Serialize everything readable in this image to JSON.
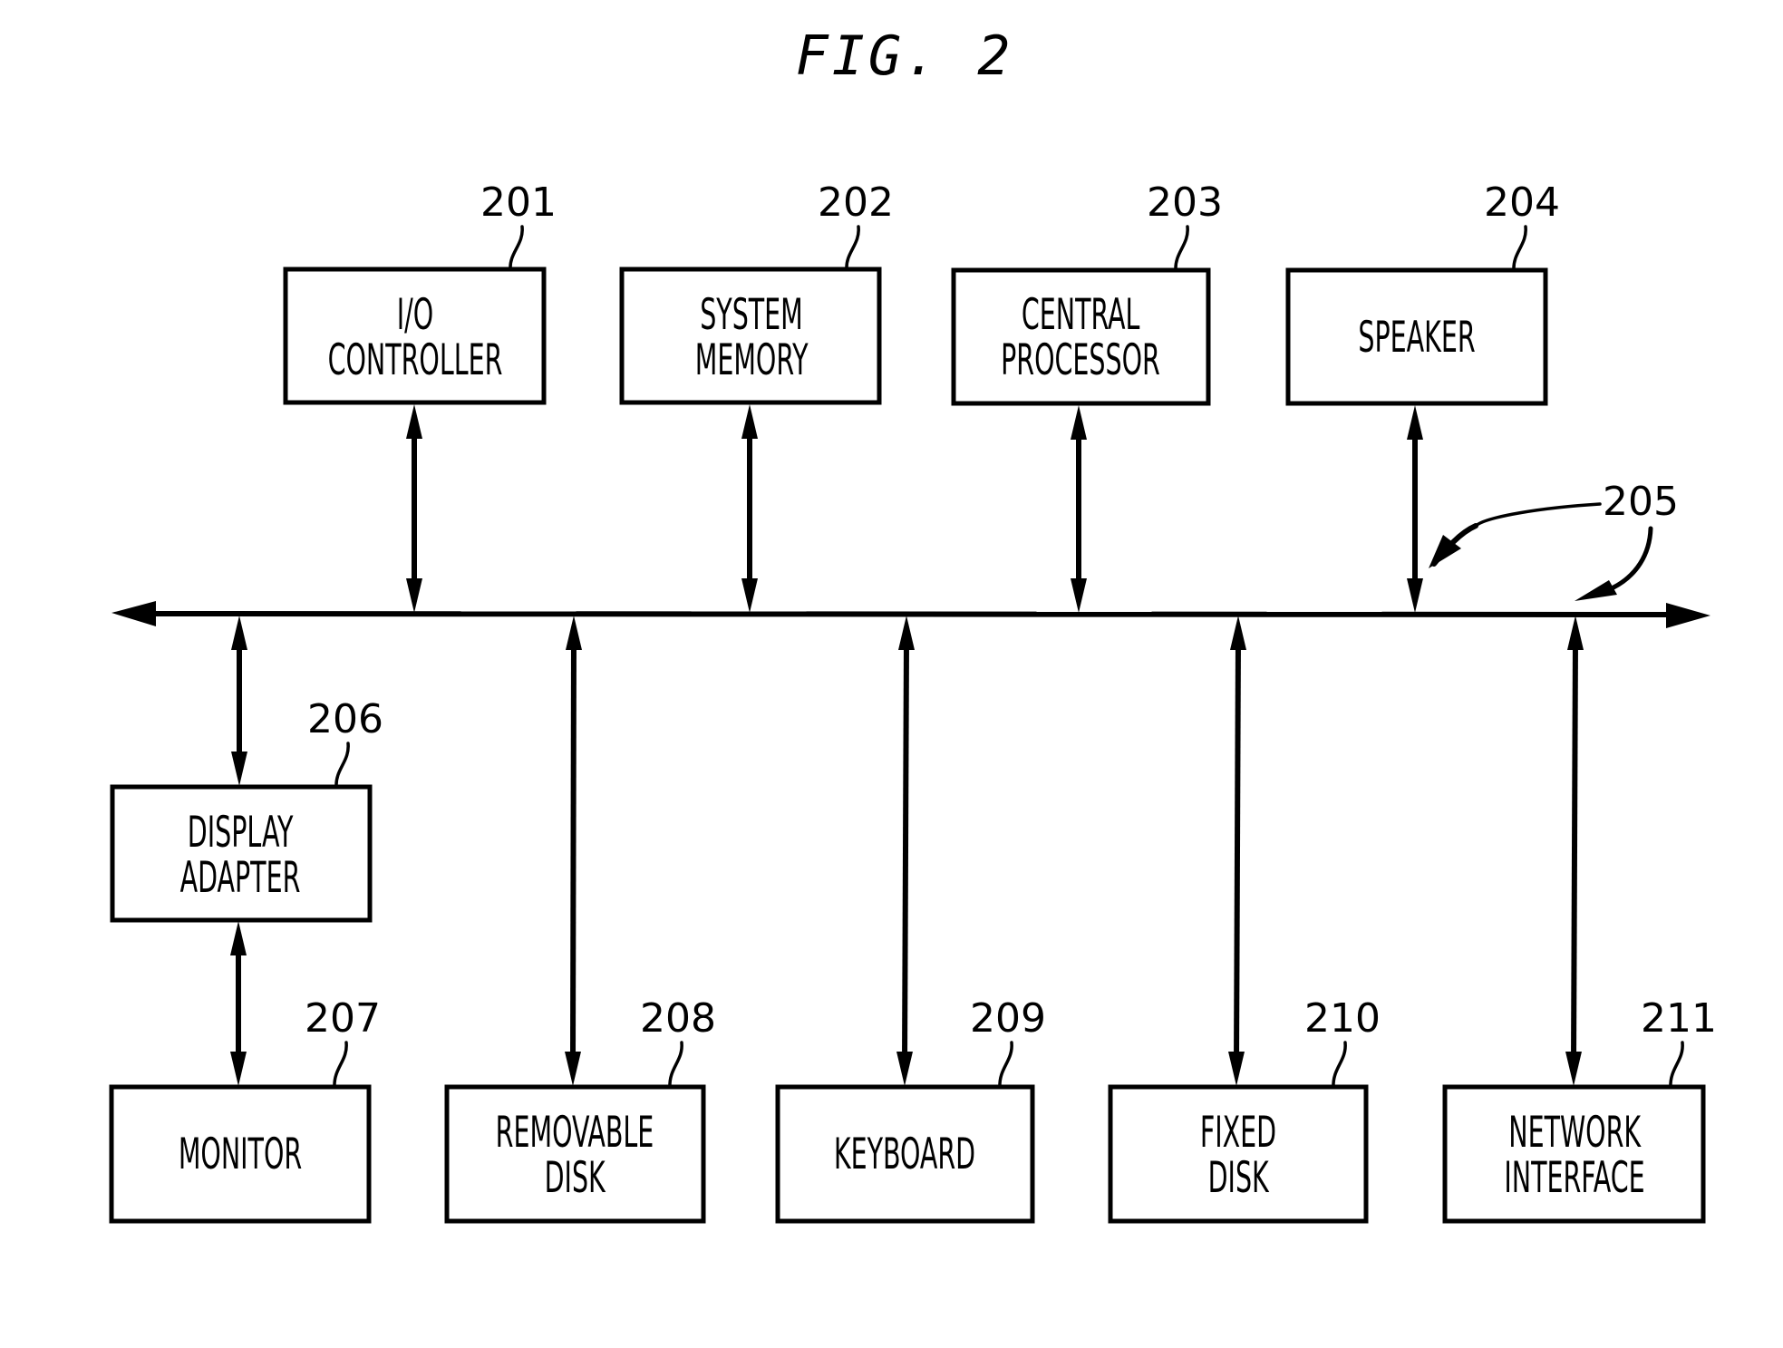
{
  "figure": {
    "title": "FIG. 2"
  },
  "bus": {
    "ref": "205"
  },
  "blocks": {
    "io_controller": {
      "ref": "201",
      "line1": "I/O",
      "line2": "CONTROLLER"
    },
    "system_memory": {
      "ref": "202",
      "line1": "SYSTEM",
      "line2": "MEMORY"
    },
    "central_processor": {
      "ref": "203",
      "line1": "CENTRAL",
      "line2": "PROCESSOR"
    },
    "speaker": {
      "ref": "204",
      "line1": "SPEAKER"
    },
    "display_adapter": {
      "ref": "206",
      "line1": "DISPLAY",
      "line2": "ADAPTER"
    },
    "monitor": {
      "ref": "207",
      "line1": "MONITOR"
    },
    "removable_disk": {
      "ref": "208",
      "line1": "REMOVABLE",
      "line2": "DISK"
    },
    "keyboard": {
      "ref": "209",
      "line1": "KEYBOARD"
    },
    "fixed_disk": {
      "ref": "210",
      "line1": "FIXED",
      "line2": "DISK"
    },
    "network_interface": {
      "ref": "211",
      "line1": "NETWORK",
      "line2": "INTERFACE"
    }
  }
}
